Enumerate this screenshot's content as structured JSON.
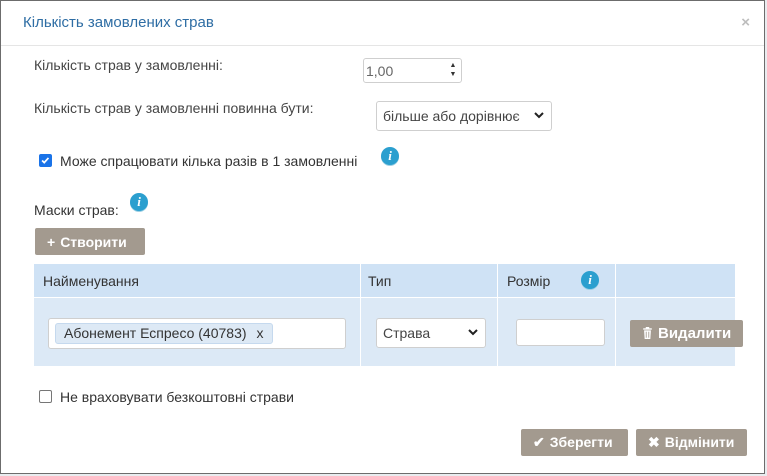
{
  "dialog": {
    "title": "Кількість замовлених страв",
    "close_label": "×"
  },
  "form": {
    "qty_label": "Кількість страв у замовленні:",
    "qty_value": "1,00",
    "condition_label": "Кількість страв у замовленні повинна бути:",
    "condition_value": "більше або дорівнює",
    "multi_label": "Може спрацювати кілька разів в 1 замовленні",
    "multi_checked": true,
    "masks_label": "Маски страв:",
    "create_label": "Створити",
    "ignore_free_label": "Не враховувати безкоштовні страви",
    "ignore_free_checked": false
  },
  "table": {
    "columns": [
      "Найменування",
      "Тип",
      "Розмір"
    ],
    "rows": [
      {
        "tag": "Абонемент Еспресо (40783)",
        "tag_remove": "x",
        "type": "Страва",
        "size": "",
        "delete_label": "Видалити"
      }
    ]
  },
  "footer": {
    "save_label": "Зберегти",
    "cancel_label": "Відмінити"
  },
  "colors": {
    "title": "#2e6da4",
    "button": "#a39a8f",
    "table_header": "#cfe2f5",
    "table_row": "#dce9f6",
    "info_icon": "#2b9fcf",
    "checkbox": "#1a73e8"
  },
  "icons": {
    "info": "i",
    "plus": "+",
    "trash": "🗑",
    "check": "✔",
    "times": "✖"
  }
}
